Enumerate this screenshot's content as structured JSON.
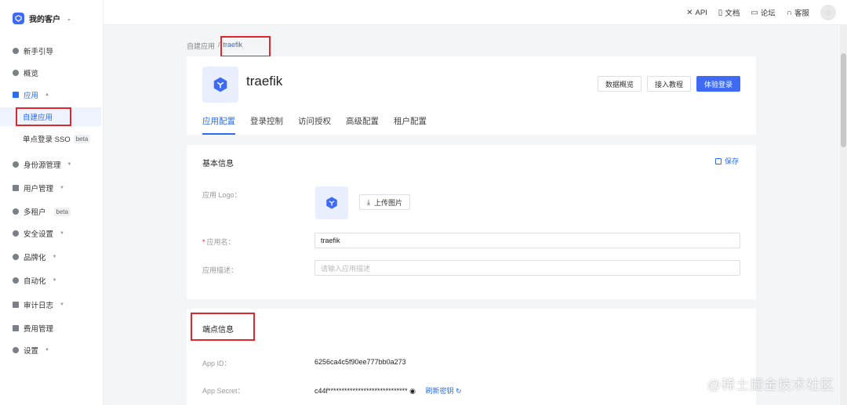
{
  "org": {
    "name": "我的客户"
  },
  "sidebar": {
    "items": [
      {
        "label": "新手引导"
      },
      {
        "label": "概览"
      },
      {
        "label": "应用"
      },
      {
        "label": "身份源管理"
      },
      {
        "label": "用户管理"
      },
      {
        "label": "多租户",
        "badge": "beta"
      },
      {
        "label": "安全设置"
      },
      {
        "label": "品牌化"
      },
      {
        "label": "自动化"
      },
      {
        "label": "审计日志"
      },
      {
        "label": "费用管理"
      },
      {
        "label": "设置"
      }
    ],
    "sub_items": [
      {
        "label": "自建应用"
      },
      {
        "label": "单点登录 SSO",
        "badge": "beta"
      }
    ]
  },
  "topbar": {
    "links": [
      {
        "label": "API",
        "icon": "tools-icon"
      },
      {
        "label": "文档",
        "icon": "book-icon"
      },
      {
        "label": "论坛",
        "icon": "chat-icon"
      },
      {
        "label": "客服",
        "icon": "headset-icon"
      }
    ]
  },
  "breadcrumb": {
    "parent": "自建应用",
    "separator": "/",
    "current": "traefik"
  },
  "app": {
    "name": "traefik",
    "buttons": {
      "overview": "数据概览",
      "tutorial": "接入教程",
      "try_login": "体验登录"
    },
    "tabs": [
      "应用配置",
      "登录控制",
      "访问授权",
      "高级配置",
      "租户配置"
    ]
  },
  "basic_info": {
    "title": "基本信息",
    "save": "保存",
    "logo_label": "应用 Logo：",
    "upload": "上传图片",
    "name_label": "应用名：",
    "name_value": "traefik",
    "desc_label": "应用描述：",
    "desc_placeholder": "请输入应用描述"
  },
  "endpoint": {
    "title": "端点信息",
    "app_id_label": "App ID：",
    "app_id": "6256ca4c5f90ee777bb0a273",
    "app_secret_label": "App Secret：",
    "app_secret": "c44f*****************************",
    "refresh": "刷新密钥"
  },
  "watermark": "@稀土掘金技术社区",
  "colors": {
    "primary": "#3f6bf4",
    "highlight": "#e0282c"
  }
}
